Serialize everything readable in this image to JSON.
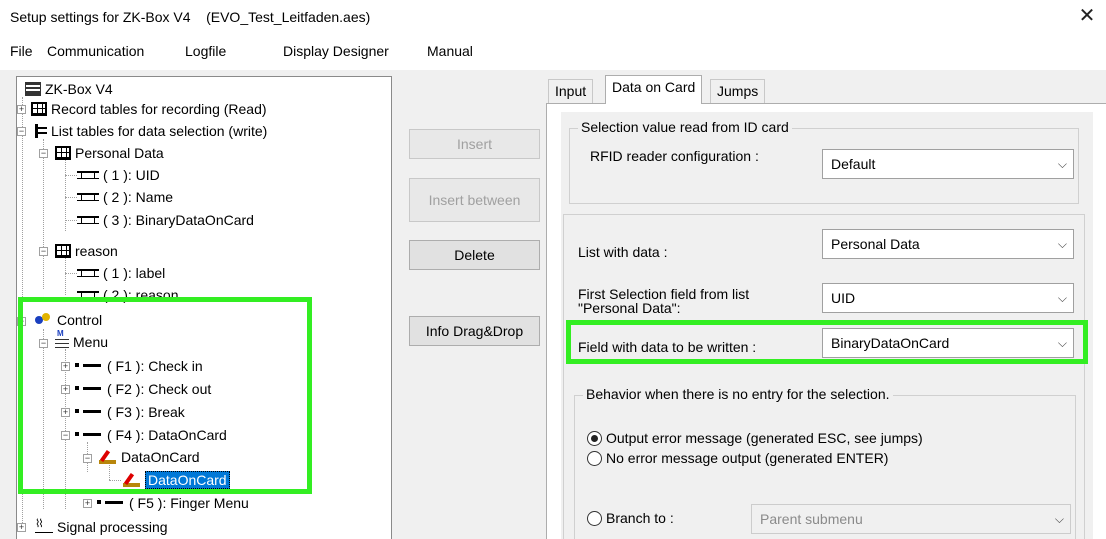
{
  "window": {
    "title": "Setup settings for ZK-Box V4    (EVO_Test_Leitfaden.aes)",
    "close_glyph": "✕"
  },
  "menu": [
    "File",
    "Communication",
    "Logfile",
    "Display Designer",
    "Manual"
  ],
  "tree": {
    "root": "ZK-Box V4",
    "record_tables": "Record tables for recording (Read)",
    "list_tables": "List tables for data selection (write)",
    "personal_data": "Personal Data",
    "pd_fields": [
      "( 1 ): UID",
      "( 2 ): Name",
      "( 3 ): BinaryDataOnCard"
    ],
    "reason": "reason",
    "reason_fields": [
      "( 1 ): label",
      "( 2 ): reason"
    ],
    "control": "Control",
    "menu": "Menu",
    "menu_items": [
      "( F1 ): Check in",
      "( F2 ): Check out",
      "( F3 ): Break",
      "( F4 ): DataOnCard"
    ],
    "dataoncard_parent": "DataOnCard",
    "dataoncard_selected": "DataOnCard",
    "f5": "( F5 ): Finger Menu",
    "signal": "Signal processing"
  },
  "buttons": {
    "insert": "Insert",
    "insert_between": "Insert between",
    "delete": "Delete",
    "info": "Info Drag&Drop"
  },
  "tabs": [
    "Input",
    "Data on Card",
    "Jumps"
  ],
  "content": {
    "group1_title": "Selection value read from ID card",
    "rfid_label": "RFID reader configuration :",
    "rfid_value": "Default",
    "list_label": "List with data :",
    "list_value": "Personal Data",
    "first_field_label_1": "First Selection field from list",
    "first_field_label_2": "\"Personal Data\":",
    "first_field_value": "UID",
    "write_label": "Field with data to be written :",
    "write_value": "BinaryDataOnCard",
    "behavior_title": "Behavior when there is no entry for the selection.",
    "radio_error": "Output error message (generated ESC, see jumps)",
    "radio_no_error": "No error message output (generated ENTER)",
    "radio_branch": "Branch to :",
    "branch_value": "Parent submenu",
    "arrow_glyph": "⌵"
  },
  "accent": {
    "highlight": "#33ee22",
    "selection": "#0078d7"
  }
}
